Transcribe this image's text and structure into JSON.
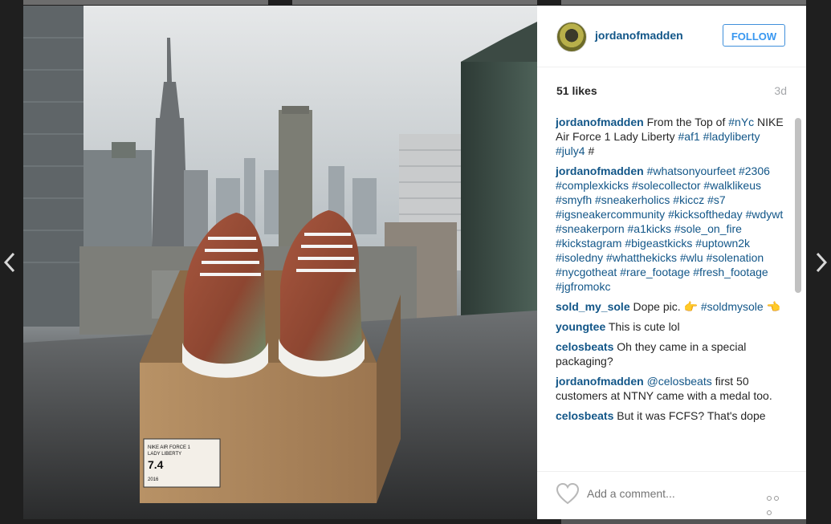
{
  "post": {
    "username": "jordanofmadden",
    "follow_label": "FOLLOW",
    "likes": "51 likes",
    "age": "3d",
    "add_comment_placeholder": "Add a comment..."
  },
  "comments": [
    {
      "user": "jordanofmadden",
      "parts": [
        {
          "t": "From the Top of ",
          "tag": false
        },
        {
          "t": "#nYc",
          "tag": true
        },
        {
          "t": " NIKE Air Force 1 Lady Liberty ",
          "tag": false
        },
        {
          "t": "#af1",
          "tag": true
        },
        {
          "t": " ",
          "tag": false
        },
        {
          "t": "#ladyliberty",
          "tag": true
        },
        {
          "t": " ",
          "tag": false
        },
        {
          "t": "#july4",
          "tag": true
        },
        {
          "t": " #",
          "tag": false
        }
      ]
    },
    {
      "user": "jordanofmadden",
      "parts": [
        {
          "t": "#whatsonyourfeet",
          "tag": true
        },
        {
          "t": " ",
          "tag": false
        },
        {
          "t": "#2306",
          "tag": true
        },
        {
          "t": " ",
          "tag": false
        },
        {
          "t": "#complexkicks",
          "tag": true
        },
        {
          "t": " ",
          "tag": false
        },
        {
          "t": "#solecollector",
          "tag": true
        },
        {
          "t": " ",
          "tag": false
        },
        {
          "t": "#walklikeus",
          "tag": true
        },
        {
          "t": " ",
          "tag": false
        },
        {
          "t": "#smyfh",
          "tag": true
        },
        {
          "t": " ",
          "tag": false
        },
        {
          "t": "#sneakerholics",
          "tag": true
        },
        {
          "t": " ",
          "tag": false
        },
        {
          "t": "#kiccz",
          "tag": true
        },
        {
          "t": " ",
          "tag": false
        },
        {
          "t": "#s7",
          "tag": true
        },
        {
          "t": " ",
          "tag": false
        },
        {
          "t": "#igsneakercommunity",
          "tag": true
        },
        {
          "t": " ",
          "tag": false
        },
        {
          "t": "#kicksoftheday",
          "tag": true
        },
        {
          "t": " ",
          "tag": false
        },
        {
          "t": "#wdywt",
          "tag": true
        },
        {
          "t": " ",
          "tag": false
        },
        {
          "t": "#sneakerporn",
          "tag": true
        },
        {
          "t": " ",
          "tag": false
        },
        {
          "t": "#a1kicks",
          "tag": true
        },
        {
          "t": " ",
          "tag": false
        },
        {
          "t": "#sole_on_fire",
          "tag": true
        },
        {
          "t": " ",
          "tag": false
        },
        {
          "t": "#kickstagram",
          "tag": true
        },
        {
          "t": " ",
          "tag": false
        },
        {
          "t": "#bigeastkicks",
          "tag": true
        },
        {
          "t": " ",
          "tag": false
        },
        {
          "t": "#uptown2k",
          "tag": true
        },
        {
          "t": " ",
          "tag": false
        },
        {
          "t": "#isoledny",
          "tag": true
        },
        {
          "t": " ",
          "tag": false
        },
        {
          "t": "#whatthekicks",
          "tag": true
        },
        {
          "t": " ",
          "tag": false
        },
        {
          "t": "#wlu",
          "tag": true
        },
        {
          "t": " ",
          "tag": false
        },
        {
          "t": "#solenation",
          "tag": true
        },
        {
          "t": " ",
          "tag": false
        },
        {
          "t": "#nycgotheat",
          "tag": true
        },
        {
          "t": " ",
          "tag": false
        },
        {
          "t": "#rare_footage",
          "tag": true
        },
        {
          "t": " ",
          "tag": false
        },
        {
          "t": "#fresh_footage",
          "tag": true
        },
        {
          "t": " ",
          "tag": false
        },
        {
          "t": "#jgfromokc",
          "tag": true
        }
      ]
    },
    {
      "user": "sold_my_sole",
      "parts": [
        {
          "t": "Dope pic. 👉 ",
          "tag": false
        },
        {
          "t": "#soldmysole",
          "tag": true
        },
        {
          "t": " 👈",
          "tag": false
        }
      ]
    },
    {
      "user": "youngtee",
      "parts": [
        {
          "t": "This is cute lol",
          "tag": false
        }
      ]
    },
    {
      "user": "celosbeats",
      "parts": [
        {
          "t": "Oh they came in a special packaging?",
          "tag": false
        }
      ]
    },
    {
      "user": "jordanofmadden",
      "parts": [
        {
          "t": "@celosbeats",
          "tag": true
        },
        {
          "t": " first 50 customers at NTNY came with a medal too.",
          "tag": false
        }
      ]
    },
    {
      "user": "celosbeats",
      "parts": [
        {
          "t": "But it was FCFS? That's dope",
          "tag": false
        }
      ]
    }
  ],
  "box_label": {
    "line1": "NIKE AIR FORCE 1",
    "line2": "LADY LIBERTY",
    "size": "7.4",
    "year": "2016"
  },
  "colors": {
    "link": "#125688",
    "follow_blue": "#3897f0",
    "text": "#262626",
    "muted": "#a5a7aa"
  },
  "icons": {
    "prev": "chevron-left-icon",
    "next": "chevron-right-icon",
    "like": "heart-icon",
    "more": "ellipsis-icon"
  }
}
